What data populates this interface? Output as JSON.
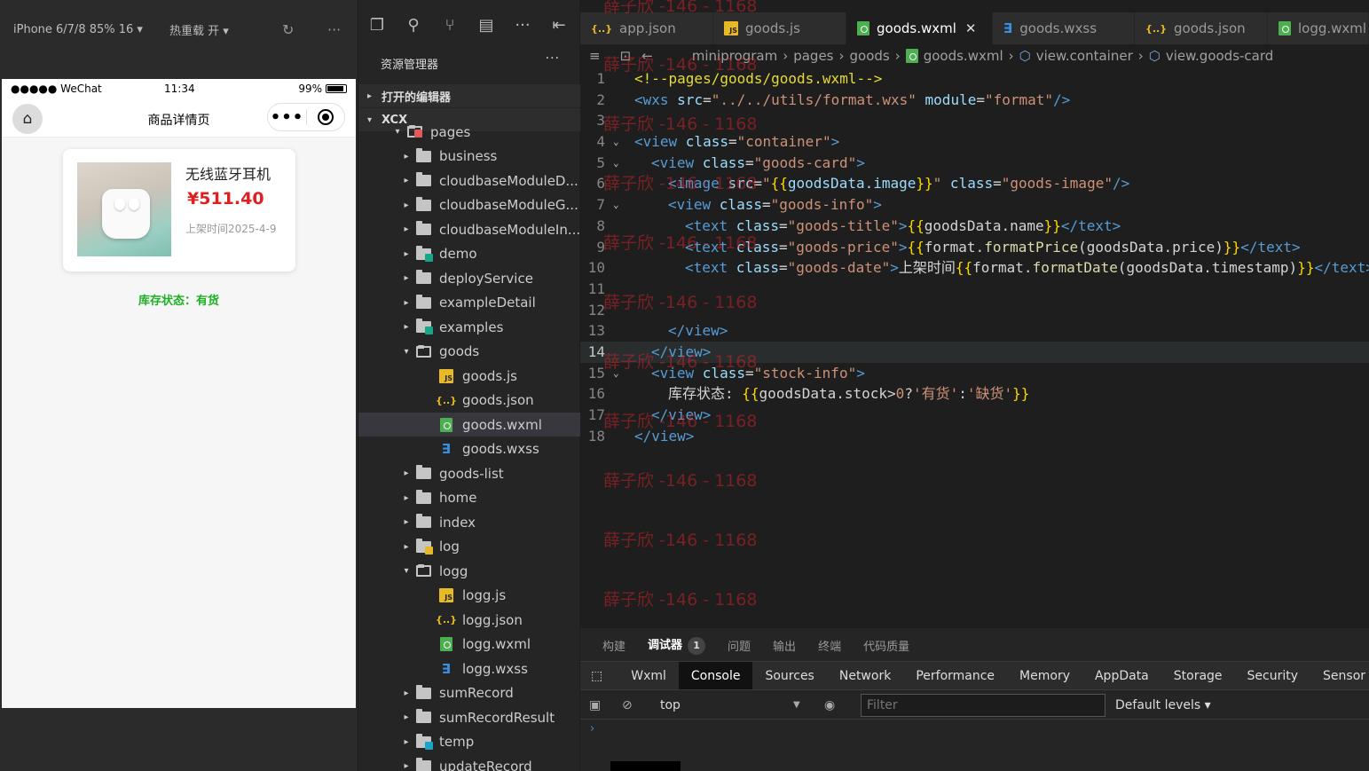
{
  "simulator": {
    "device": "iPhone 6/7/8 85% 16 ▾",
    "hot_reload": "热重载 开 ▾",
    "status": {
      "signal": "●●●●● WeChat",
      "time": "11:34",
      "battery": "99%"
    },
    "nav_title": "商品详情页",
    "goods": {
      "name": "无线蓝牙耳机",
      "price": "¥511.40",
      "date": "上架时间2025-4-9"
    },
    "stock": "库存状态：有货"
  },
  "explorer": {
    "title": "资源管理器",
    "more": "···",
    "open_editors": "打开的编辑器",
    "project": "XCX",
    "items": [
      {
        "label": "pages",
        "depth": 1,
        "kind": "folder-open",
        "badge": "#e05a5a",
        "chev": "▾"
      },
      {
        "label": "business",
        "depth": 2,
        "kind": "folder",
        "chev": "▸"
      },
      {
        "label": "cloudbaseModuleD...",
        "depth": 2,
        "kind": "folder",
        "chev": "▸"
      },
      {
        "label": "cloudbaseModuleG...",
        "depth": 2,
        "kind": "folder",
        "chev": "▸"
      },
      {
        "label": "cloudbaseModuleIn...",
        "depth": 2,
        "kind": "folder",
        "chev": "▸"
      },
      {
        "label": "demo",
        "depth": 2,
        "kind": "folder",
        "badge": "#1aa58a",
        "chev": "▸"
      },
      {
        "label": "deployService",
        "depth": 2,
        "kind": "folder",
        "chev": "▸"
      },
      {
        "label": "exampleDetail",
        "depth": 2,
        "kind": "folder",
        "chev": "▸"
      },
      {
        "label": "examples",
        "depth": 2,
        "kind": "folder",
        "badge": "#1aa58a",
        "chev": "▸"
      },
      {
        "label": "goods",
        "depth": 2,
        "kind": "folder-open",
        "chev": "▾"
      },
      {
        "label": "goods.js",
        "depth": 3,
        "kind": "js"
      },
      {
        "label": "goods.json",
        "depth": 3,
        "kind": "json"
      },
      {
        "label": "goods.wxml",
        "depth": 3,
        "kind": "wxml",
        "selected": true
      },
      {
        "label": "goods.wxss",
        "depth": 3,
        "kind": "wxss"
      },
      {
        "label": "goods-list",
        "depth": 2,
        "kind": "folder",
        "chev": "▸"
      },
      {
        "label": "home",
        "depth": 2,
        "kind": "folder",
        "chev": "▸"
      },
      {
        "label": "index",
        "depth": 2,
        "kind": "folder",
        "chev": "▸"
      },
      {
        "label": "log",
        "depth": 2,
        "kind": "folder",
        "badge": "#e8b926",
        "chev": "▸"
      },
      {
        "label": "logg",
        "depth": 2,
        "kind": "folder-open",
        "chev": "▾"
      },
      {
        "label": "logg.js",
        "depth": 3,
        "kind": "js"
      },
      {
        "label": "logg.json",
        "depth": 3,
        "kind": "json"
      },
      {
        "label": "logg.wxml",
        "depth": 3,
        "kind": "wxml"
      },
      {
        "label": "logg.wxss",
        "depth": 3,
        "kind": "wxss"
      },
      {
        "label": "sumRecord",
        "depth": 2,
        "kind": "folder",
        "chev": "▸"
      },
      {
        "label": "sumRecordResult",
        "depth": 2,
        "kind": "folder",
        "chev": "▸"
      },
      {
        "label": "temp",
        "depth": 2,
        "kind": "folder",
        "badge": "#1aa5c8",
        "chev": "▸"
      },
      {
        "label": "updateRecord",
        "depth": 2,
        "kind": "folder",
        "chev": "▸"
      }
    ]
  },
  "editor": {
    "tabs": [
      {
        "label": "app.json",
        "icon": "json"
      },
      {
        "label": "goods.js",
        "icon": "js"
      },
      {
        "label": "goods.wxml",
        "icon": "wxml",
        "active": true
      },
      {
        "label": "goods.wxss",
        "icon": "wxss"
      },
      {
        "label": "goods.json",
        "icon": "json"
      },
      {
        "label": "logg.wxml",
        "icon": "wxml"
      }
    ],
    "breadcrumb": [
      "miniprogram",
      "pages",
      "goods",
      "goods.wxml",
      "view.container",
      "view.goods-card"
    ],
    "lines": [
      {
        "n": "1",
        "fold": "",
        "indent": 0,
        "tokens": [
          [
            "t-com2",
            "<!--pages/goods/goods.wxml-->"
          ]
        ]
      },
      {
        "n": "2",
        "fold": "",
        "indent": 0,
        "tokens": [
          [
            "t-tag",
            "<wxs "
          ],
          [
            "t-att",
            "src"
          ],
          [
            "t-eq",
            "="
          ],
          [
            "t-str",
            "\"../../utils/format.wxs\""
          ],
          [
            "t-att",
            " module"
          ],
          [
            "t-eq",
            "="
          ],
          [
            "t-str",
            "\"format\""
          ],
          [
            "t-tag",
            "/>"
          ]
        ]
      },
      {
        "n": "3",
        "fold": "",
        "indent": 0,
        "tokens": []
      },
      {
        "n": "4",
        "fold": "⌄",
        "indent": 0,
        "tokens": [
          [
            "t-tag",
            "<view "
          ],
          [
            "t-att",
            "class"
          ],
          [
            "t-eq",
            "="
          ],
          [
            "t-str",
            "\"container\""
          ],
          [
            "t-tag",
            ">"
          ]
        ]
      },
      {
        "n": "5",
        "fold": "⌄",
        "indent": 1,
        "tokens": [
          [
            "t-tag",
            "<view "
          ],
          [
            "t-att",
            "class"
          ],
          [
            "t-eq",
            "="
          ],
          [
            "t-str",
            "\"goods-card\""
          ],
          [
            "t-tag",
            ">"
          ]
        ]
      },
      {
        "n": "6",
        "fold": "",
        "indent": 2,
        "tokens": [
          [
            "t-tag",
            "<image "
          ],
          [
            "t-att",
            "src"
          ],
          [
            "t-eq",
            "="
          ],
          [
            "t-str",
            "\""
          ],
          [
            "t-br",
            "{{"
          ],
          [
            "t-att",
            "goodsData.image"
          ],
          [
            "t-br",
            "}}"
          ],
          [
            "t-str",
            "\""
          ],
          [
            "t-att",
            " class"
          ],
          [
            "t-eq",
            "="
          ],
          [
            "t-str",
            "\"goods-image\""
          ],
          [
            "t-tag",
            "/>"
          ]
        ]
      },
      {
        "n": "7",
        "fold": "⌄",
        "indent": 2,
        "tokens": [
          [
            "t-tag",
            "<view "
          ],
          [
            "t-att",
            "class"
          ],
          [
            "t-eq",
            "="
          ],
          [
            "t-str",
            "\"goods-info\""
          ],
          [
            "t-tag",
            ">"
          ]
        ]
      },
      {
        "n": "8",
        "fold": "",
        "indent": 3,
        "tokens": [
          [
            "t-tag",
            "<text "
          ],
          [
            "t-att",
            "class"
          ],
          [
            "t-eq",
            "="
          ],
          [
            "t-str",
            "\"goods-title\""
          ],
          [
            "t-tag",
            ">"
          ],
          [
            "t-br",
            "{{"
          ],
          [
            "t-txt",
            "goodsData.name"
          ],
          [
            "t-br",
            "}}"
          ],
          [
            "t-tag",
            "</text>"
          ]
        ]
      },
      {
        "n": "9",
        "fold": "",
        "indent": 3,
        "tokens": [
          [
            "t-tag",
            "<text "
          ],
          [
            "t-att",
            "class"
          ],
          [
            "t-eq",
            "="
          ],
          [
            "t-str",
            "\"goods-price\""
          ],
          [
            "t-tag",
            ">"
          ],
          [
            "t-br",
            "{{"
          ],
          [
            "t-txt",
            "format."
          ],
          [
            "t-fn",
            "formatPrice"
          ],
          [
            "t-txt",
            "(goodsData.price)"
          ],
          [
            "t-br",
            "}}"
          ],
          [
            "t-tag",
            "</text>"
          ]
        ]
      },
      {
        "n": "10",
        "fold": "",
        "indent": 3,
        "tokens": [
          [
            "t-tag",
            "<text "
          ],
          [
            "t-att",
            "class"
          ],
          [
            "t-eq",
            "="
          ],
          [
            "t-str",
            "\"goods-date\""
          ],
          [
            "t-tag",
            ">"
          ],
          [
            "t-txt",
            "上架时间"
          ],
          [
            "t-br",
            "{{"
          ],
          [
            "t-txt",
            "format."
          ],
          [
            "t-fn",
            "formatDate"
          ],
          [
            "t-txt",
            "(goodsData.timestamp)"
          ],
          [
            "t-br",
            "}}"
          ],
          [
            "t-tag",
            "</text>"
          ]
        ]
      },
      {
        "n": "11",
        "fold": "",
        "indent": 0,
        "tokens": []
      },
      {
        "n": "12",
        "fold": "",
        "indent": 0,
        "tokens": []
      },
      {
        "n": "13",
        "fold": "",
        "indent": 2,
        "tokens": [
          [
            "t-tag",
            "</view>"
          ]
        ]
      },
      {
        "n": "14",
        "fold": "",
        "indent": 1,
        "tokens": [
          [
            "t-tag",
            "</view>"
          ]
        ],
        "current": true
      },
      {
        "n": "15",
        "fold": "⌄",
        "indent": 1,
        "tokens": [
          [
            "t-tag",
            "<view "
          ],
          [
            "t-att",
            "class"
          ],
          [
            "t-eq",
            "="
          ],
          [
            "t-str",
            "\"stock-info\""
          ],
          [
            "t-tag",
            ">"
          ]
        ]
      },
      {
        "n": "16",
        "fold": "",
        "indent": 2,
        "tokens": [
          [
            "t-txt",
            "库存状态: "
          ],
          [
            "t-br",
            "{{"
          ],
          [
            "t-txt",
            "goodsData.stock>"
          ],
          [
            "t-str",
            "0"
          ],
          [
            "t-txt",
            "?"
          ],
          [
            "t-str",
            "'有货'"
          ],
          [
            "t-txt",
            ":"
          ],
          [
            "t-str",
            "'缺货'"
          ],
          [
            "t-br",
            "}}"
          ]
        ]
      },
      {
        "n": "17",
        "fold": "",
        "indent": 1,
        "tokens": [
          [
            "t-tag",
            "</view>"
          ]
        ]
      },
      {
        "n": "18",
        "fold": "",
        "indent": 0,
        "tokens": [
          [
            "t-tag",
            "</view>"
          ]
        ]
      }
    ],
    "watermark": "薛子欣 -146 - 1168"
  },
  "panel": {
    "tabs": [
      "构建",
      "调试器",
      "问题",
      "输出",
      "终端",
      "代码质量"
    ],
    "debugger_count": "1",
    "devtools_tabs": [
      "Wxml",
      "Console",
      "Sources",
      "Network",
      "Performance",
      "Memory",
      "AppData",
      "Storage",
      "Security",
      "Sensor"
    ],
    "context": "top",
    "filter_placeholder": "Filter",
    "levels": "Default levels ▾",
    "prompt": "›"
  }
}
